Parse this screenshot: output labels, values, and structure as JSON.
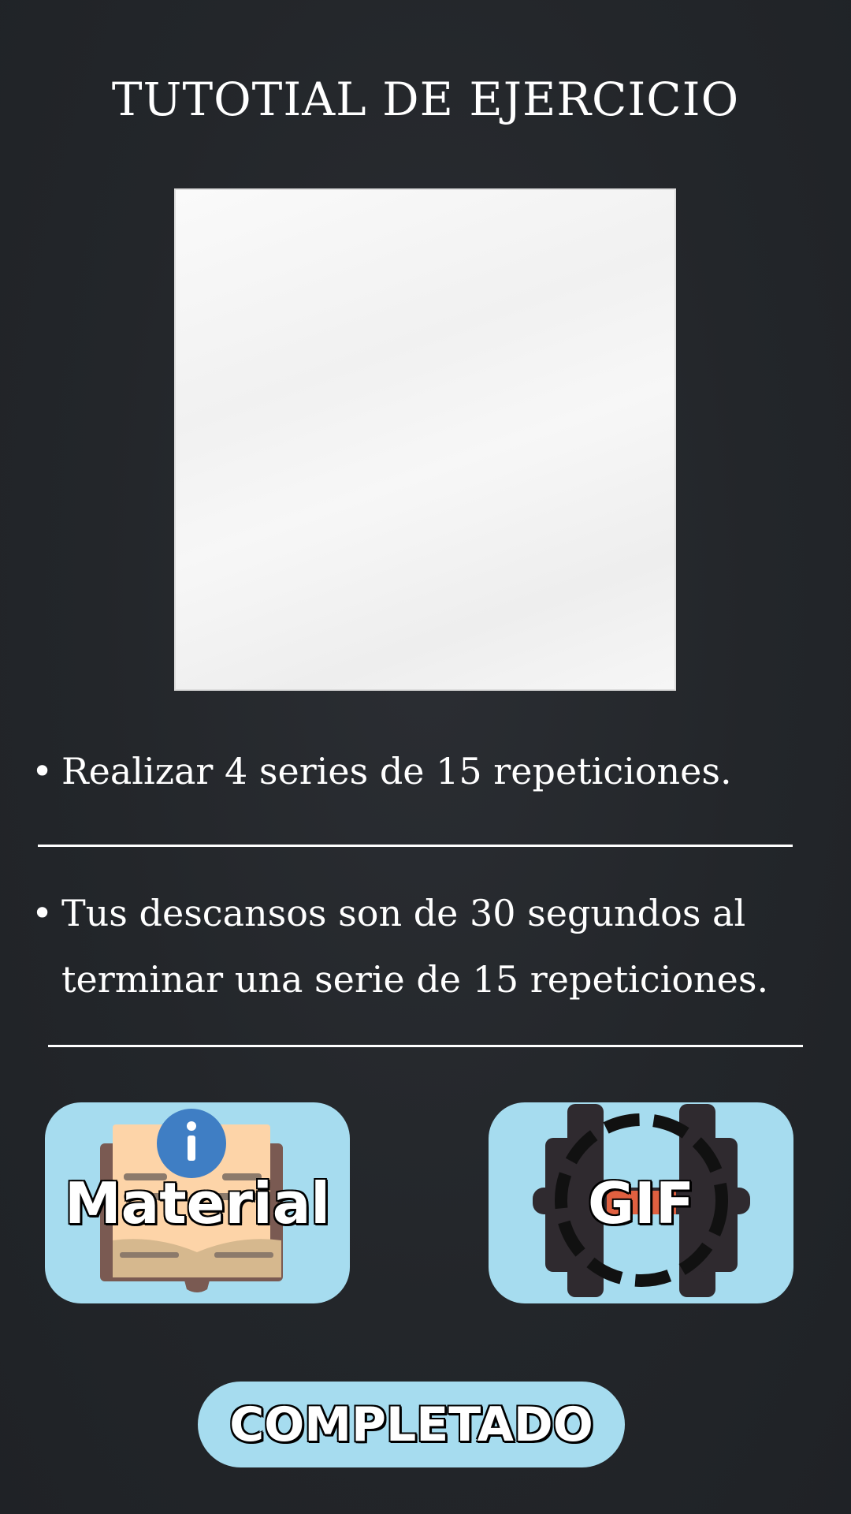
{
  "header": {
    "title": "TUTOTIAL DE EJERCICIO"
  },
  "media": {
    "icon": "image-placeholder-icon"
  },
  "instructions": [
    {
      "lines": [
        "Realizar 4 series de 15 repeticiones."
      ]
    },
    {
      "lines": [
        "Tus descansos son de 30 segundos al",
        "terminar una serie de 15 repeticiones."
      ]
    }
  ],
  "buttons": {
    "material": {
      "label": "Material",
      "icon": "book-info-icon"
    },
    "gif": {
      "label": "GIF",
      "icon": "dumbbell-loading-icon"
    },
    "completado": {
      "label": "COMPLETADO"
    }
  },
  "colors": {
    "background": "#23262a",
    "button": "#a6dcef",
    "text": "#ffffff"
  }
}
